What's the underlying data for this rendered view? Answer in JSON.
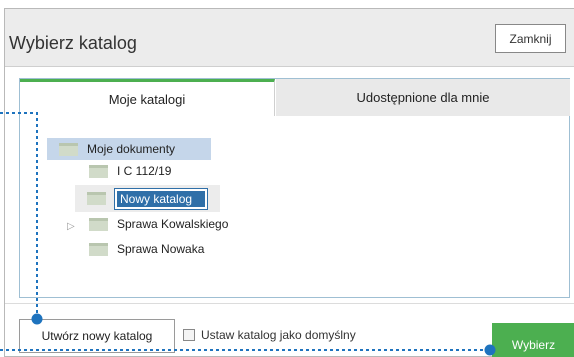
{
  "dialog": {
    "title": "Wybierz katalog",
    "close_label": "Zamknij"
  },
  "tabs": [
    {
      "label": "Moje katalogi",
      "active": true
    },
    {
      "label": "Udostępnione dla mnie",
      "active": false
    }
  ],
  "tree": {
    "root": "Moje dokumenty",
    "children": [
      {
        "label": "I C 112/19"
      },
      {
        "label": "Nowy katalog",
        "editing": true
      },
      {
        "label": "Sprawa Kowalskiego",
        "collapsed": true
      },
      {
        "label": "Sprawa Nowaka"
      }
    ]
  },
  "footer": {
    "create_label": "Utwórz nowy katalog",
    "default_label": "Ustaw katalog jako domyślny",
    "choose_label": "Wybierz"
  },
  "colors": {
    "accent_green": "#4caf50",
    "selection_blue": "#2f6fa8",
    "annotation_blue": "#1e73be"
  }
}
